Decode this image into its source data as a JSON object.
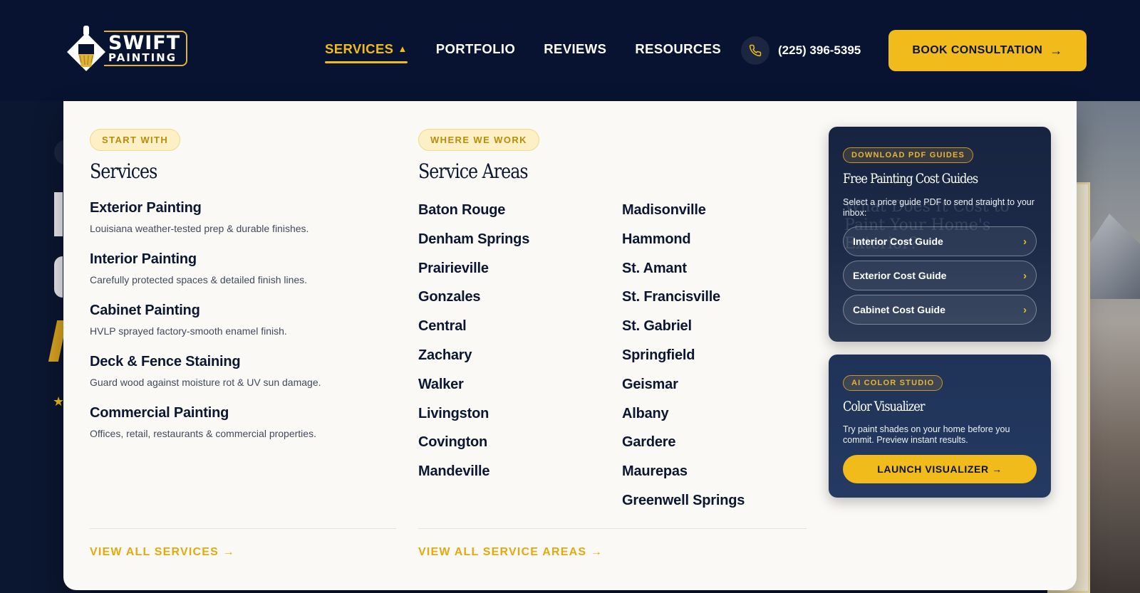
{
  "header": {
    "logo": {
      "line1": "SWIFT",
      "line2": "PAINTING"
    },
    "nav": [
      {
        "label": "SERVICES",
        "caret": "▲"
      },
      {
        "label": "PORTFOLIO"
      },
      {
        "label": "REVIEWS"
      },
      {
        "label": "RESOURCES"
      }
    ],
    "phone": "(225) 396-5395",
    "book_label": "BOOK CONSULTATION",
    "book_arrow": "→"
  },
  "menu": {
    "services": {
      "eyebrow": "START WITH",
      "heading": "Services",
      "items": [
        {
          "title": "Exterior Painting",
          "desc": "Louisiana weather-tested prep & durable finishes."
        },
        {
          "title": "Interior Painting",
          "desc": "Carefully protected spaces & detailed finish lines."
        },
        {
          "title": "Cabinet Painting",
          "desc": "HVLP sprayed factory-smooth enamel finish."
        },
        {
          "title": "Deck & Fence Staining",
          "desc": "Guard wood against moisture rot & UV sun damage."
        },
        {
          "title": "Commercial Painting",
          "desc": "Offices, retail, restaurants & commercial properties."
        }
      ],
      "view_all": "VIEW ALL SERVICES →"
    },
    "areas": {
      "eyebrow": "WHERE WE WORK",
      "heading": "Service Areas",
      "col1": [
        "Baton Rouge",
        "Denham Springs",
        "Prairieville",
        "Gonzales",
        "Central",
        "Zachary",
        "Walker",
        "Livingston",
        "Covington",
        "Mandeville"
      ],
      "col2": [
        "Madisonville",
        "Hammond",
        "St. Amant",
        "St. Francisville",
        "St. Gabriel",
        "Springfield",
        "Geismar",
        "Albany",
        "Gardere",
        "Maurepas",
        "Greenwell Springs"
      ],
      "view_all": "VIEW ALL SERVICE AREAS →"
    },
    "guides_card": {
      "eyebrow": "DOWNLOAD PDF GUIDES",
      "title": "Free Painting Cost Guides",
      "desc": "Select a price guide PDF to send straight to your inbox:",
      "guides": [
        "Interior Cost Guide",
        "Exterior Cost Guide",
        "Cabinet Cost Guide"
      ],
      "chevron": "›"
    },
    "visualizer_card": {
      "eyebrow": "AI COLOR STUDIO",
      "title": "Color Visualizer",
      "desc": "Try paint shades on your home before you commit. Preview instant results.",
      "button": "LAUNCH VISUALIZER →"
    }
  },
  "colors": {
    "navy": "#071330",
    "gold": "#f1bb1c",
    "panel": "#faf9f6"
  }
}
